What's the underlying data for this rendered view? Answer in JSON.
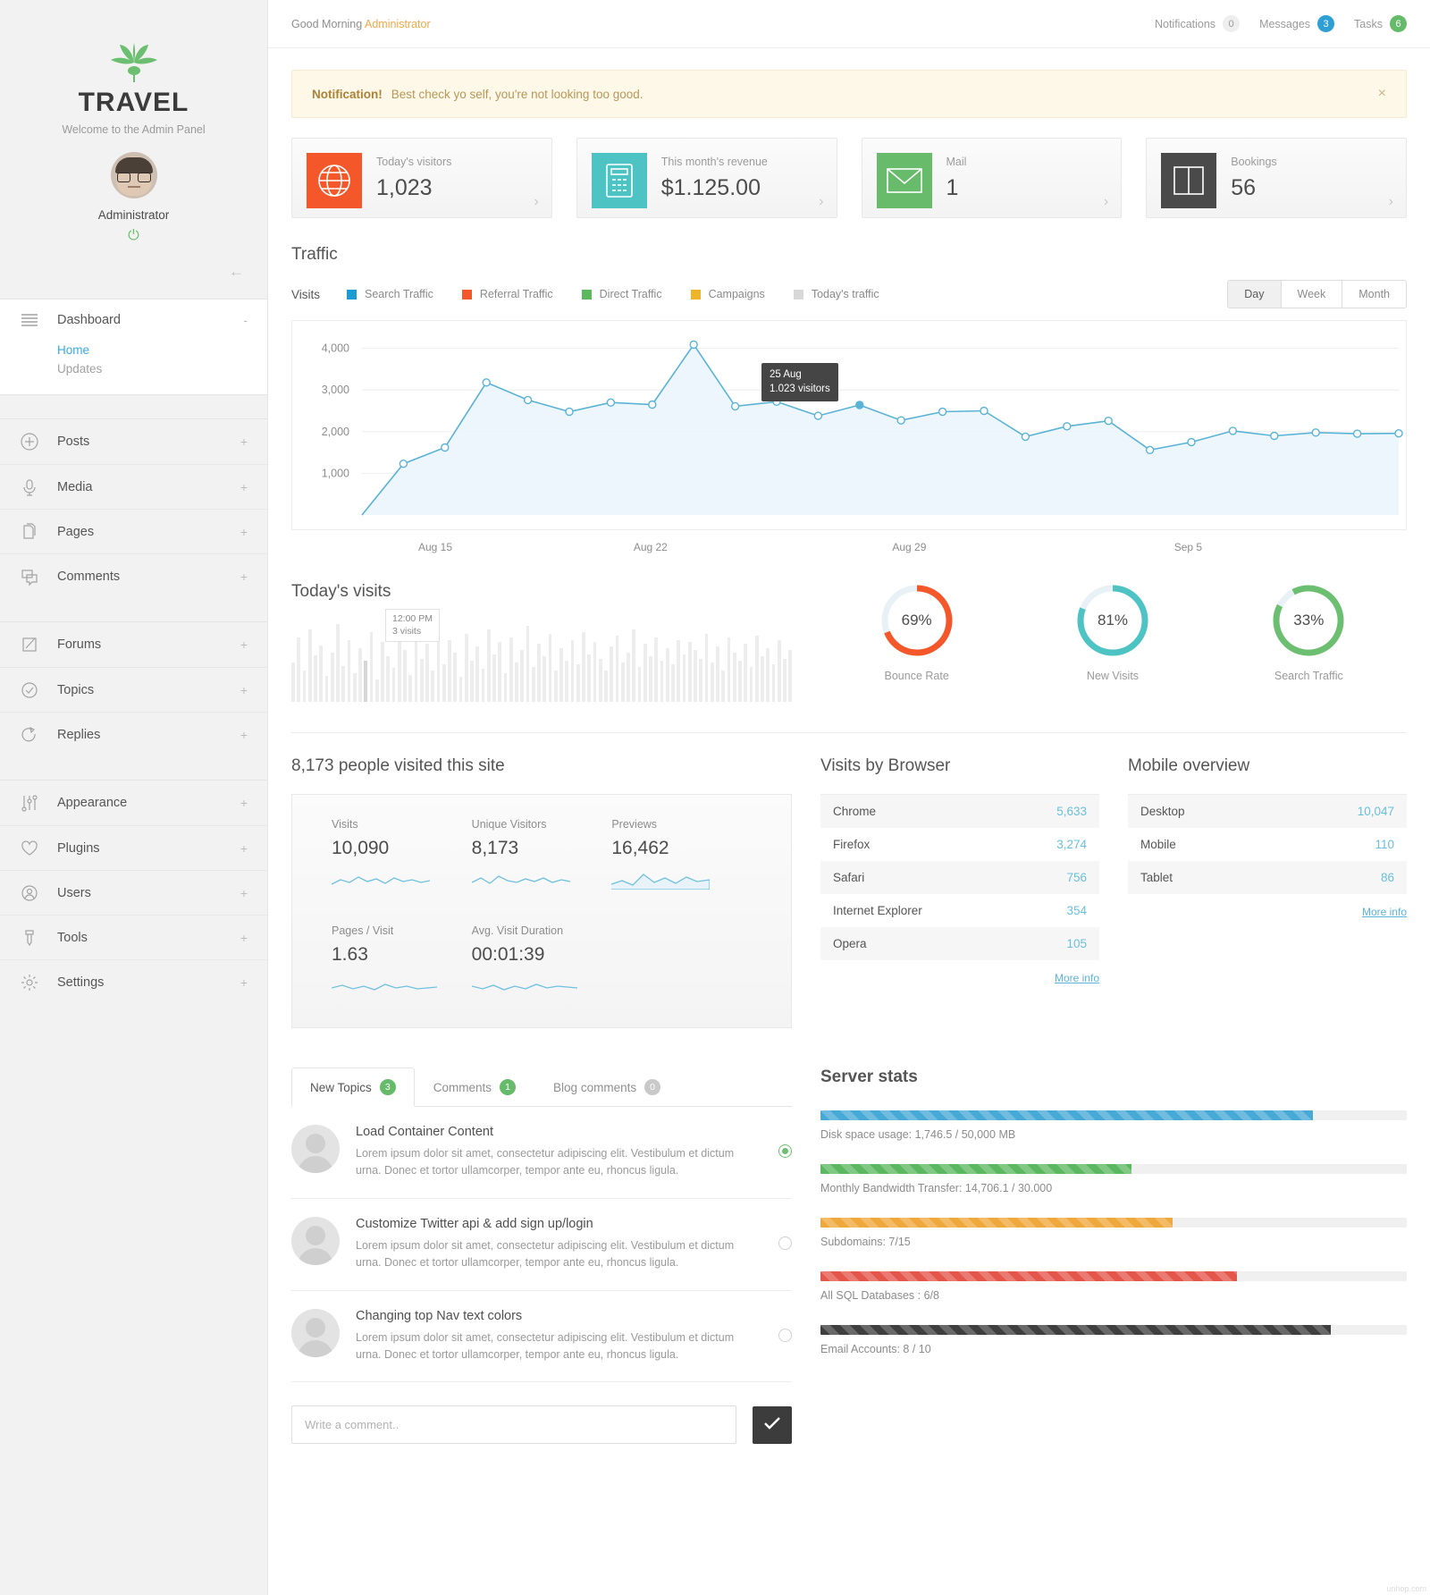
{
  "sidebar": {
    "brand_title": "TRAVEL",
    "brand_sub": "Welcome to the Admin Panel",
    "user_name": "Administrator",
    "dashboard": {
      "label": "Dashboard",
      "sub": [
        {
          "label": "Home",
          "active": true
        },
        {
          "label": "Updates",
          "active": false
        }
      ]
    },
    "groups": [
      {
        "items": [
          {
            "label": "Posts",
            "icon": "plus-circle-icon"
          },
          {
            "label": "Media",
            "icon": "microphone-icon"
          },
          {
            "label": "Pages",
            "icon": "pages-icon"
          },
          {
            "label": "Comments",
            "icon": "comments-icon"
          }
        ]
      },
      {
        "items": [
          {
            "label": "Forums",
            "icon": "pencil-square-icon"
          },
          {
            "label": "Topics",
            "icon": "check-circle-icon"
          },
          {
            "label": "Replies",
            "icon": "reply-arrow-icon"
          }
        ]
      },
      {
        "items": [
          {
            "label": "Appearance",
            "icon": "sliders-icon"
          },
          {
            "label": "Plugins",
            "icon": "heart-icon"
          },
          {
            "label": "Users",
            "icon": "user-circle-icon"
          },
          {
            "label": "Tools",
            "icon": "tools-icon"
          },
          {
            "label": "Settings",
            "icon": "gear-icon"
          }
        ]
      }
    ]
  },
  "topbar": {
    "greeting": "Good Morning ",
    "greeting_user": "Administrator",
    "counters": [
      {
        "label": "Notifications",
        "count": "0",
        "style": "grey"
      },
      {
        "label": "Messages",
        "count": "3",
        "style": "blue"
      },
      {
        "label": "Tasks",
        "count": "6",
        "style": "green"
      }
    ]
  },
  "alert": {
    "title": "Notification!",
    "message": "Best check yo self, you're not looking too good.",
    "close": "×"
  },
  "cards": [
    {
      "label": "Today's visitors",
      "value": "1,023",
      "icon": "globe-icon",
      "color": "#f4582a"
    },
    {
      "label": "This month's revenue",
      "value": "$1.125.00",
      "icon": "calculator-icon",
      "color": "#4ec3c4"
    },
    {
      "label": "Mail",
      "value": "1",
      "icon": "envelope-icon",
      "color": "#67bb6a"
    },
    {
      "label": "Bookings",
      "value": "56",
      "icon": "book-icon",
      "color": "#4a4a4a"
    }
  ],
  "traffic": {
    "title": "Traffic",
    "legend_first": "Visits",
    "legend": [
      {
        "label": "Search Traffic",
        "color": "#1b9bd1"
      },
      {
        "label": "Referral Traffic",
        "color": "#f4582a"
      },
      {
        "label": "Direct Traffic",
        "color": "#5cb85c"
      },
      {
        "label": "Campaigns",
        "color": "#f0b429"
      },
      {
        "label": "Today's traffic",
        "color": "#d8d8d8"
      }
    ],
    "ranges": [
      {
        "label": "Day",
        "active": true
      },
      {
        "label": "Week",
        "active": false
      },
      {
        "label": "Month",
        "active": false
      }
    ],
    "tooltip": {
      "date": "25 Aug",
      "value": "1.023 visitors"
    }
  },
  "chart_data": {
    "type": "line",
    "title": "Traffic",
    "xlabel": "",
    "ylabel": "Visits",
    "ylim": [
      0,
      4400
    ],
    "yticks": [
      1000,
      2000,
      3000,
      4000
    ],
    "ytick_labels": [
      "1,000",
      "2,000",
      "3,000",
      "4,000"
    ],
    "xtick_labels": [
      "Aug 15",
      "Aug 22",
      "Aug 29",
      "Sep 5"
    ],
    "xtick_positions_pct": [
      12.9,
      32.2,
      55.4,
      80.4
    ],
    "grid": true,
    "legend_position": "top",
    "line_color": "#5ab3d6",
    "fill_color": "#eaf5fb",
    "series": [
      {
        "name": "Visits",
        "x": [
          "Aug 13",
          "Aug 14",
          "Aug 15",
          "Aug 16",
          "Aug 17",
          "Aug 18",
          "Aug 19",
          "Aug 20",
          "Aug 21",
          "Aug 22",
          "Aug 23",
          "Aug 24",
          "Aug 25",
          "Aug 26",
          "Aug 27",
          "Aug 28",
          "Aug 29",
          "Aug 30",
          "Aug 31",
          "Sep 1",
          "Sep 2",
          "Sep 3",
          "Sep 4",
          "Sep 5",
          "Sep 6",
          "Sep 7"
        ],
        "values": [
          0,
          1230,
          1620,
          3180,
          2760,
          2480,
          2700,
          2650,
          4090,
          2610,
          2720,
          2380,
          2640,
          2270,
          2480,
          2500,
          1880,
          2130,
          2260,
          1560,
          1750,
          2020,
          1900,
          1980,
          1950,
          1960
        ]
      }
    ],
    "highlight_point": {
      "x": "25 Aug",
      "y": 1023,
      "label": "25 Aug / 1.023 visitors"
    }
  },
  "today_visits": {
    "title": "Today's visits",
    "tooltip": {
      "time": "12:00 PM",
      "value": "3 visits"
    },
    "bars": [
      38,
      62,
      30,
      70,
      45,
      55,
      25,
      48,
      75,
      35,
      60,
      28,
      52,
      40,
      68,
      22,
      58,
      44,
      33,
      72,
      50,
      26,
      64,
      42,
      56,
      30,
      78,
      36,
      60,
      48,
      24,
      66,
      40,
      54,
      32,
      70,
      46,
      58,
      28,
      62,
      38,
      50,
      74,
      34,
      56,
      44,
      66,
      30,
      52,
      40,
      60,
      36,
      68,
      46,
      58,
      42,
      30,
      54,
      64,
      38,
      48,
      70,
      34,
      56,
      44,
      62,
      40,
      52,
      36,
      60,
      46,
      58,
      50,
      42,
      66,
      38,
      54,
      30,
      62,
      48,
      40,
      56,
      34,
      64,
      44,
      52,
      36,
      60,
      42,
      50
    ],
    "highlight_bar_index": 13
  },
  "donuts": [
    {
      "value": "69%",
      "percent": 69,
      "label": "Bounce Rate",
      "color": "#f4582a"
    },
    {
      "value": "81%",
      "percent": 81,
      "label": "New Visits",
      "color": "#4ec3c4"
    },
    {
      "value": "33%",
      "percent": 33,
      "label": "Search Traffic",
      "color": "#6cbf70"
    }
  ],
  "site_stats": {
    "title": "8,173 people visited this site",
    "row1": [
      {
        "caption": "Visits",
        "value": "10,090"
      },
      {
        "caption": "Unique Visitors",
        "value": "8,173"
      },
      {
        "caption": "Previews",
        "value": "16,462"
      }
    ],
    "row2": [
      {
        "caption": "Pages / Visit",
        "value": "1.63"
      },
      {
        "caption": "Avg. Visit Duration",
        "value": "00:01:39"
      }
    ]
  },
  "browsers": {
    "title": "Visits by Browser",
    "rows": [
      {
        "name": "Chrome",
        "value": "5,633"
      },
      {
        "name": "Firefox",
        "value": "3,274"
      },
      {
        "name": "Safari",
        "value": "756"
      },
      {
        "name": "Internet Explorer",
        "value": "354"
      },
      {
        "name": "Opera",
        "value": "105"
      }
    ],
    "more": "More info"
  },
  "mobile": {
    "title": "Mobile overview",
    "rows": [
      {
        "name": "Desktop",
        "value": "10,047"
      },
      {
        "name": "Mobile",
        "value": "110"
      },
      {
        "name": "Tablet",
        "value": "86"
      }
    ],
    "more": "More info"
  },
  "topics_panel": {
    "tabs": [
      {
        "label": "New Topics",
        "count": "3",
        "badge": "green",
        "active": true
      },
      {
        "label": "Comments",
        "count": "1",
        "badge": "green",
        "active": false
      },
      {
        "label": "Blog comments",
        "count": "0",
        "badge": "grey",
        "active": false
      }
    ],
    "items": [
      {
        "title": "Load Container Content",
        "desc": "Lorem ipsum dolor sit amet, consectetur adipiscing elit. Vestibulum et dictum urna. Donec et tortor ullamcorper, tempor ante eu, rhoncus ligula.",
        "selected": true
      },
      {
        "title": "Customize Twitter api & add sign up/login",
        "desc": "Lorem ipsum dolor sit amet, consectetur adipiscing elit. Vestibulum et dictum urna. Donec et tortor ullamcorper, tempor ante eu, rhoncus ligula.",
        "selected": false
      },
      {
        "title": "Changing top Nav text colors",
        "desc": "Lorem ipsum dolor sit amet, consectetur adipiscing elit. Vestibulum et dictum urna. Donec et tortor ullamcorper, tempor ante eu, rhoncus ligula.",
        "selected": false
      }
    ],
    "comment_placeholder": "Write a comment..",
    "send_icon": "check-icon"
  },
  "server_stats": {
    "title": "Server stats",
    "bars": [
      {
        "label": "Disk space usage: 1,746.5 / 50,000 MB",
        "percent": 84,
        "color": "#47a9d6"
      },
      {
        "label": "Monthly Bandwidth Transfer: 14,706.1 / 30.000",
        "percent": 53,
        "color": "#5cb860"
      },
      {
        "label": "Subdomains: 7/15",
        "percent": 60,
        "color": "#efa83b"
      },
      {
        "label": "All SQL Databases : 6/8",
        "percent": 71,
        "color": "#e4564a"
      },
      {
        "label": "Email Accounts: 8 / 10",
        "percent": 87,
        "color": "#3f3f3f"
      }
    ]
  },
  "watermark": "unhop.com"
}
